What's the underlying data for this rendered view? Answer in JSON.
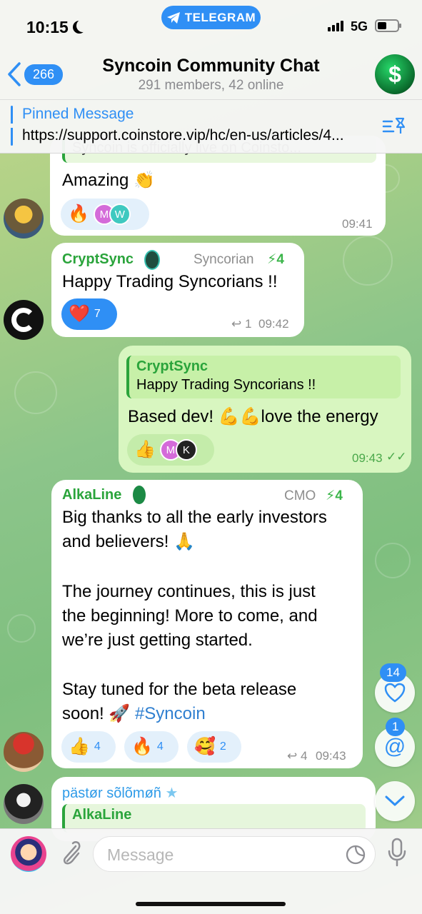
{
  "status": {
    "time": "10:15",
    "network": "5G"
  },
  "header": {
    "telegram_label": "TELEGRAM",
    "back_count": "266",
    "title": "Syncoin Community Chat",
    "subtitle": "291 members, 42 online",
    "avatar_glyph": "$"
  },
  "pinned": {
    "title": "Pinned Message",
    "text": "https://support.coinstore.vip/hc/en-us/articles/4..."
  },
  "messages": [
    {
      "id": "m1",
      "quote_fragment": "Syncoin is officially live on Coinsto...",
      "text": "Amazing 👏",
      "reactions": [
        {
          "emoji": "🔥"
        },
        {
          "avatars": [
            "M",
            "W"
          ]
        }
      ],
      "time": "09:41"
    },
    {
      "id": "m2",
      "sender": "CryptSync",
      "role": "Syncorian",
      "boost": "4",
      "text": "Happy Trading Syncorians !!",
      "reactions": [
        {
          "emoji": "❤️",
          "count": "7"
        }
      ],
      "replies": "1",
      "time": "09:42"
    },
    {
      "id": "m3",
      "outgoing": true,
      "quote_sender": "CryptSync",
      "quote_text": "Happy Trading Syncorians !!",
      "text": "Based dev! 💪💪love the energy",
      "reactions": [
        {
          "emoji": "👍",
          "avatars": [
            "M",
            "K"
          ]
        }
      ],
      "time": "09:43"
    },
    {
      "id": "m4",
      "sender": "AlkaLine",
      "role": "CMO",
      "boost": "4",
      "line1": "Big thanks to all the early investors",
      "line2": "and believers! 🙏",
      "line3": "The journey continues, this is just",
      "line4": "the beginning! More to come, and",
      "line5": "we’re just getting started.",
      "line6": "Stay tuned for the beta release",
      "line7_prefix": "soon! 🚀 ",
      "line7_hashtag": "#Syncoin",
      "reactions": [
        {
          "emoji": "👍",
          "count": "4"
        },
        {
          "emoji": "🔥",
          "count": "4"
        },
        {
          "emoji": "🥰",
          "count": "2"
        }
      ],
      "replies": "4",
      "time": "09:43"
    },
    {
      "id": "m5",
      "sender": "pästør sõlõmøñ",
      "quote_sender": "AlkaLine"
    }
  ],
  "floating": {
    "likes": "14",
    "mentions": "1"
  },
  "input": {
    "placeholder": "Message"
  }
}
